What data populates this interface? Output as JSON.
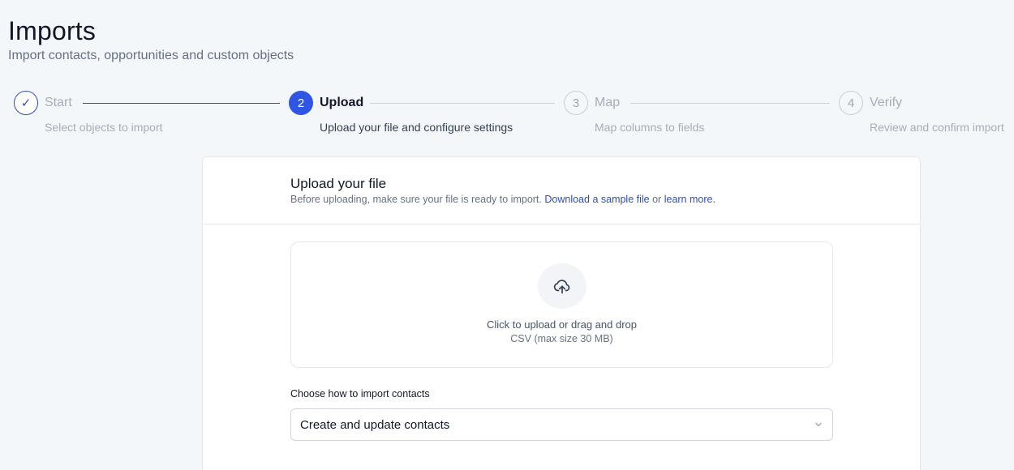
{
  "header": {
    "title": "Imports",
    "subtitle": "Import contacts, opportunities and custom objects"
  },
  "stepper": {
    "steps": [
      {
        "marker": "✓",
        "title": "Start",
        "description": "Select objects to import",
        "state": "done"
      },
      {
        "marker": "2",
        "title": "Upload",
        "description": "Upload your file and configure settings",
        "state": "active"
      },
      {
        "marker": "3",
        "title": "Map",
        "description": "Map columns to fields",
        "state": "todo"
      },
      {
        "marker": "4",
        "title": "Verify",
        "description": "Review and confirm import",
        "state": "todo"
      }
    ]
  },
  "upload_card": {
    "title": "Upload your file",
    "help_prefix": "Before uploading, make sure your file is ready to import.",
    "sample_link": "Download a sample file",
    "help_or": "or",
    "learn_link": "learn more.",
    "dropzone": {
      "icon": "cloud-upload-icon",
      "main_text": "Click to upload or drag and drop",
      "sub_text": "CSV (max size 30 MB)"
    },
    "import_mode": {
      "label": "Choose how to import contacts",
      "selected": "Create and update contacts"
    }
  },
  "colors": {
    "accent": "#2f55e4",
    "accent_dark": "#2e4fb6",
    "muted": "#a7adb8",
    "background": "#f4f7fa"
  }
}
